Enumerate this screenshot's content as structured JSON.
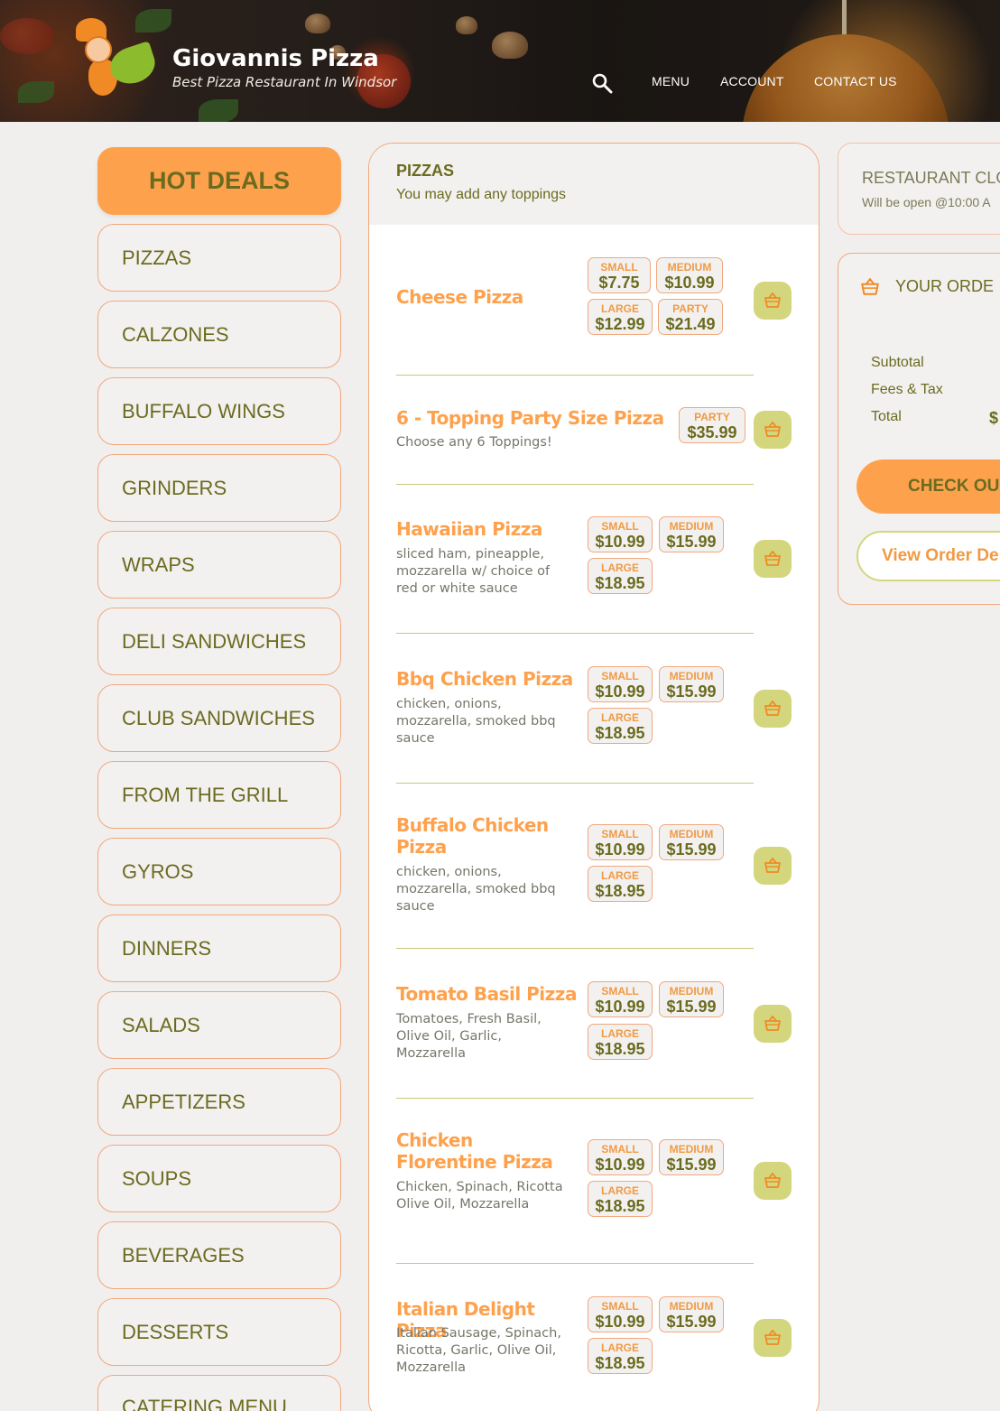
{
  "header": {
    "title": "Giovannis Pizza",
    "tagline": "Best Pizza Restaurant In Windsor",
    "nav": [
      "MENU",
      "ACCOUNT",
      "CONTACT US"
    ]
  },
  "categories": [
    "HOT DEALS",
    "PIZZAS",
    "CALZONES",
    "BUFFALO WINGS",
    "GRINDERS",
    "WRAPS",
    "DELI SANDWICHES",
    "CLUB SANDWICHES",
    "FROM THE GRILL",
    "GYROS",
    "DINNERS",
    "SALADS",
    "APPETIZERS",
    "SOUPS",
    "BEVERAGES",
    "DESSERTS",
    "CATERING MENU"
  ],
  "menu": {
    "section_title": "PIZZAS",
    "section_subtitle": "You may add any toppings",
    "items": [
      {
        "name": "Cheese Pizza",
        "desc": "",
        "prices": [
          {
            "label": "SMALL",
            "value": "$7.75"
          },
          {
            "label": "MEDIUM",
            "value": "$10.99"
          },
          {
            "label": "LARGE",
            "value": "$12.99"
          },
          {
            "label": "PARTY",
            "value": "$21.49"
          }
        ]
      },
      {
        "name": "6 - Topping Party Size Pizza",
        "desc": "Choose any 6 Toppings!",
        "prices": [
          {
            "label": "PARTY",
            "value": "$35.99"
          }
        ]
      },
      {
        "name": "Hawaiian Pizza",
        "desc": "sliced ham, pineapple, mozzarella w/ choice of red or white sauce",
        "prices": [
          {
            "label": "SMALL",
            "value": "$10.99"
          },
          {
            "label": "MEDIUM",
            "value": "$15.99"
          },
          {
            "label": "LARGE",
            "value": "$18.95"
          }
        ]
      },
      {
        "name": "Bbq Chicken Pizza",
        "desc": "chicken, onions, mozzarella, smoked bbq sauce",
        "prices": [
          {
            "label": "SMALL",
            "value": "$10.99"
          },
          {
            "label": "MEDIUM",
            "value": "$15.99"
          },
          {
            "label": "LARGE",
            "value": "$18.95"
          }
        ]
      },
      {
        "name": "Buffalo Chicken Pizza",
        "desc": "chicken, onions, mozzarella, smoked bbq sauce",
        "prices": [
          {
            "label": "SMALL",
            "value": "$10.99"
          },
          {
            "label": "MEDIUM",
            "value": "$15.99"
          },
          {
            "label": "LARGE",
            "value": "$18.95"
          }
        ]
      },
      {
        "name": "Tomato Basil Pizza",
        "desc": "Tomatoes, Fresh Basil, Olive Oil, Garlic, Mozzarella",
        "prices": [
          {
            "label": "SMALL",
            "value": "$10.99"
          },
          {
            "label": "MEDIUM",
            "value": "$15.99"
          },
          {
            "label": "LARGE",
            "value": "$18.95"
          }
        ]
      },
      {
        "name": "Chicken Florentine Pizza",
        "desc": "Chicken, Spinach, Ricotta Olive Oil, Mozzarella",
        "prices": [
          {
            "label": "SMALL",
            "value": "$10.99"
          },
          {
            "label": "MEDIUM",
            "value": "$15.99"
          },
          {
            "label": "LARGE",
            "value": "$18.95"
          }
        ]
      },
      {
        "name": "Italian Delight Pizza",
        "desc": "Italian Sausage, Spinach, Ricotta, Garlic, Olive Oil, Mozzarella",
        "prices": [
          {
            "label": "SMALL",
            "value": "$10.99"
          },
          {
            "label": "MEDIUM",
            "value": "$15.99"
          },
          {
            "label": "LARGE",
            "value": "$18.95"
          }
        ]
      }
    ]
  },
  "status": {
    "title": "RESTAURANT CLO",
    "subtitle": "Will be open @10:00 A"
  },
  "order": {
    "title": "YOUR ORDE",
    "subtotal_label": "Subtotal",
    "fees_label": "Fees & Tax",
    "total_label": "Total",
    "total_value": "$",
    "checkout_label": "CHECK OU",
    "view_details_label": "View Order De"
  },
  "colors": {
    "accent": "#fea14d",
    "olive": "#6b6b1f",
    "cart": "#d3d67c"
  },
  "icons": {
    "search": "search-icon",
    "basket": "basket-icon"
  }
}
